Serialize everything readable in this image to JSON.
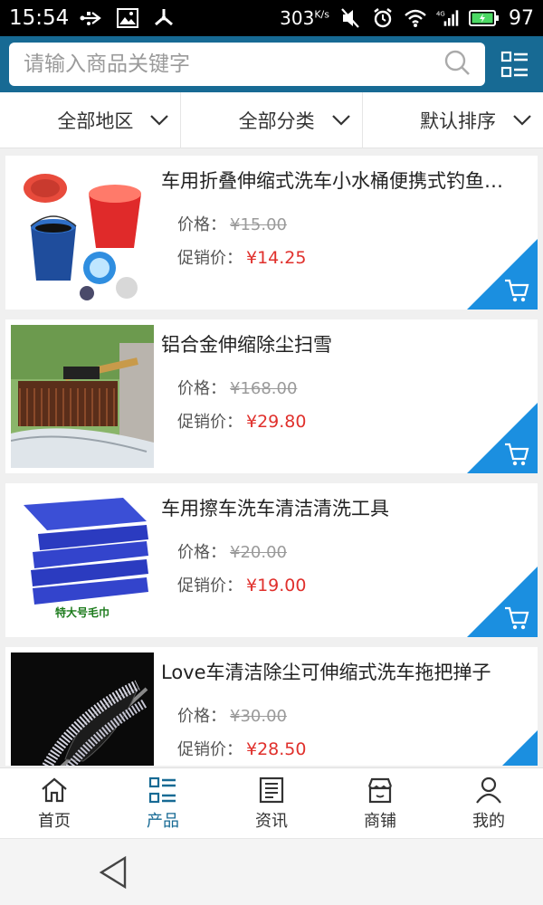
{
  "status_bar": {
    "time": "15:54",
    "speed": "303",
    "speed_unit": "K/s",
    "battery": "97"
  },
  "search": {
    "placeholder": "请输入商品关键字"
  },
  "filters": [
    {
      "label": "全部地区"
    },
    {
      "label": "全部分类"
    },
    {
      "label": "默认排序"
    }
  ],
  "products": [
    {
      "title": "车用折叠伸缩式洗车小水桶便携式钓鱼…",
      "price_label": "价格：",
      "price": "¥15.00",
      "promo_label": "促销价：",
      "promo_price": "¥14.25",
      "image": "folding-bucket"
    },
    {
      "title": "铝合金伸缩除尘扫雪",
      "price_label": "价格：",
      "price": "¥168.00",
      "promo_label": "促销价：",
      "promo_price": "¥29.80",
      "image": "telescopic-duster"
    },
    {
      "title": "车用擦车洗车清洁清洗工具",
      "price_label": "价格：",
      "price": "¥20.00",
      "promo_label": "促销价：",
      "promo_price": "¥19.00",
      "image": "blue-towels",
      "image_caption": "特大号毛巾"
    },
    {
      "title": "Love车清洁除尘可伸缩式洗车拖把掸子",
      "price_label": "价格：",
      "price": "¥30.00",
      "promo_label": "促销价：",
      "promo_price": "¥28.50",
      "image": "chenille-mop"
    }
  ],
  "tabs": [
    {
      "label": "首页",
      "icon": "home-icon"
    },
    {
      "label": "产品",
      "icon": "list-icon",
      "active": true
    },
    {
      "label": "资讯",
      "icon": "news-icon"
    },
    {
      "label": "商铺",
      "icon": "shop-icon"
    },
    {
      "label": "我的",
      "icon": "user-icon"
    }
  ],
  "colors": {
    "header": "#176a94",
    "accent": "#1b8fe0",
    "promo_price": "#e0302c"
  }
}
